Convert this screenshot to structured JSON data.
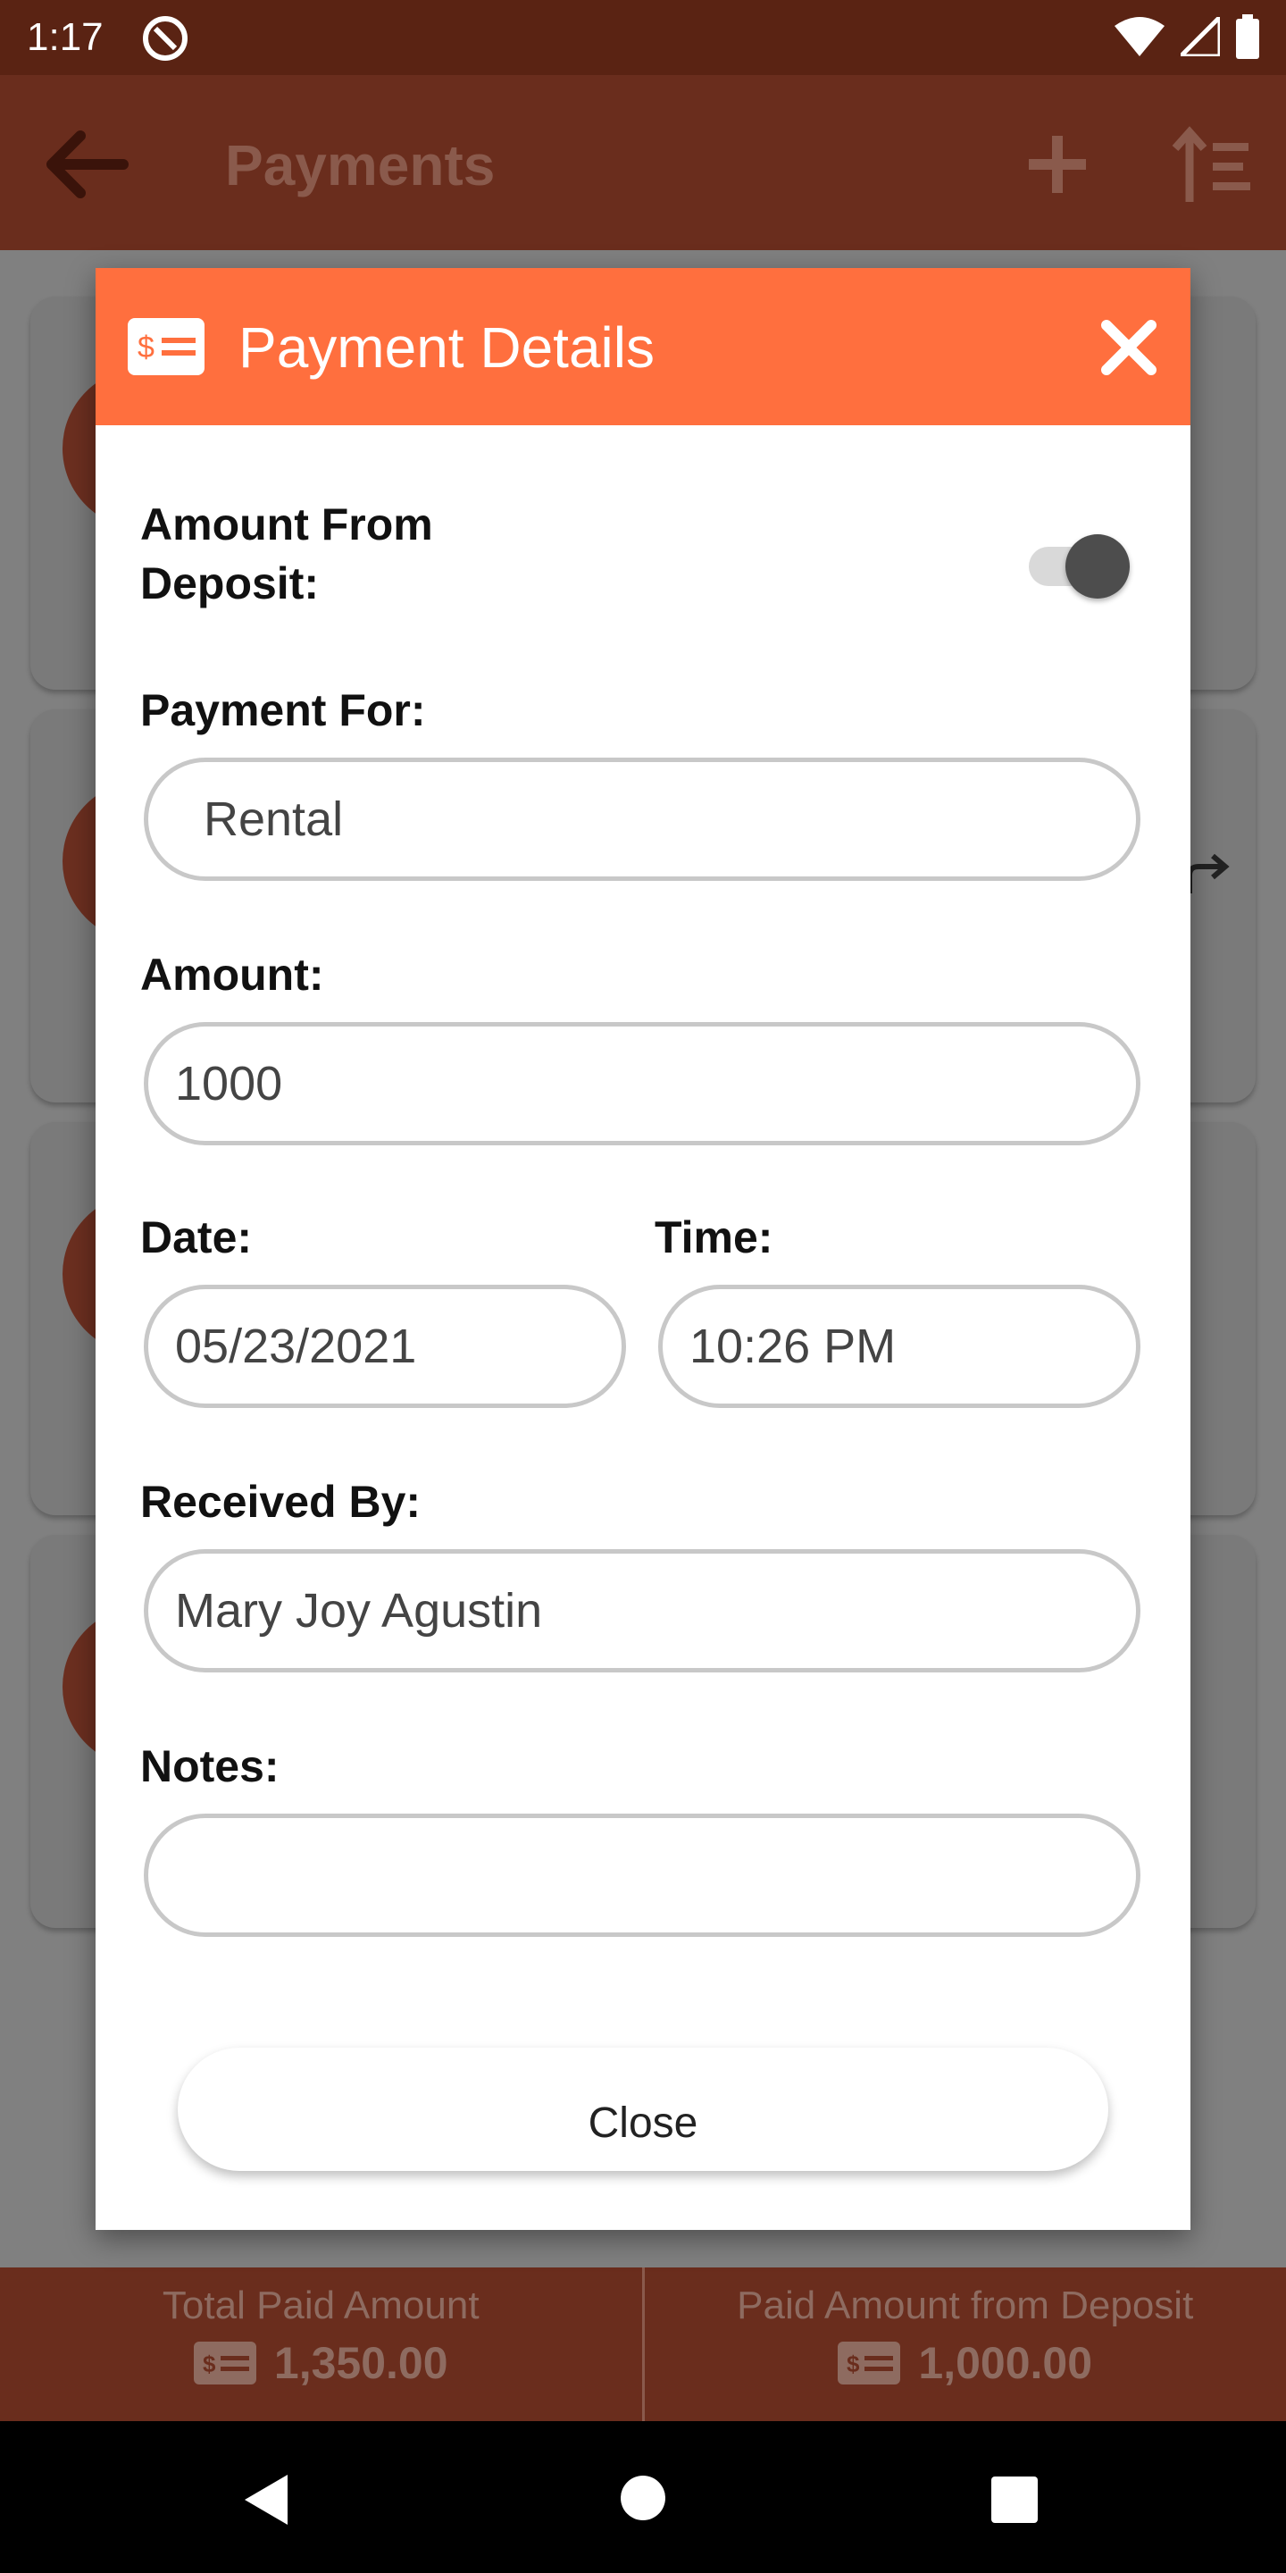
{
  "status_bar": {
    "time": "1:17"
  },
  "app_bar": {
    "title": "Payments"
  },
  "dialog": {
    "title": "Payment Details",
    "amount_from_deposit_label": "Amount From Deposit:",
    "payment_for_label": "Payment For:",
    "payment_for_value": "Rental",
    "amount_label": "Amount:",
    "amount_value": "1000",
    "date_label": "Date:",
    "date_value": "05/23/2021",
    "time_label": "Time:",
    "time_value": "10:26 PM",
    "received_by_label": "Received By:",
    "received_by_value": "Mary Joy Agustin",
    "notes_label": "Notes:",
    "notes_value": "",
    "close_label": "Close"
  },
  "footer": {
    "total_paid_label": "Total Paid Amount",
    "total_paid_value": "1,350.00",
    "paid_from_deposit_label": "Paid Amount from Deposit",
    "paid_from_deposit_value": "1,000.00"
  },
  "colors": {
    "header_orange": "#ff6f3e",
    "app_bar_dim": "#6a2d1d",
    "status_bar": "#5a2313"
  }
}
